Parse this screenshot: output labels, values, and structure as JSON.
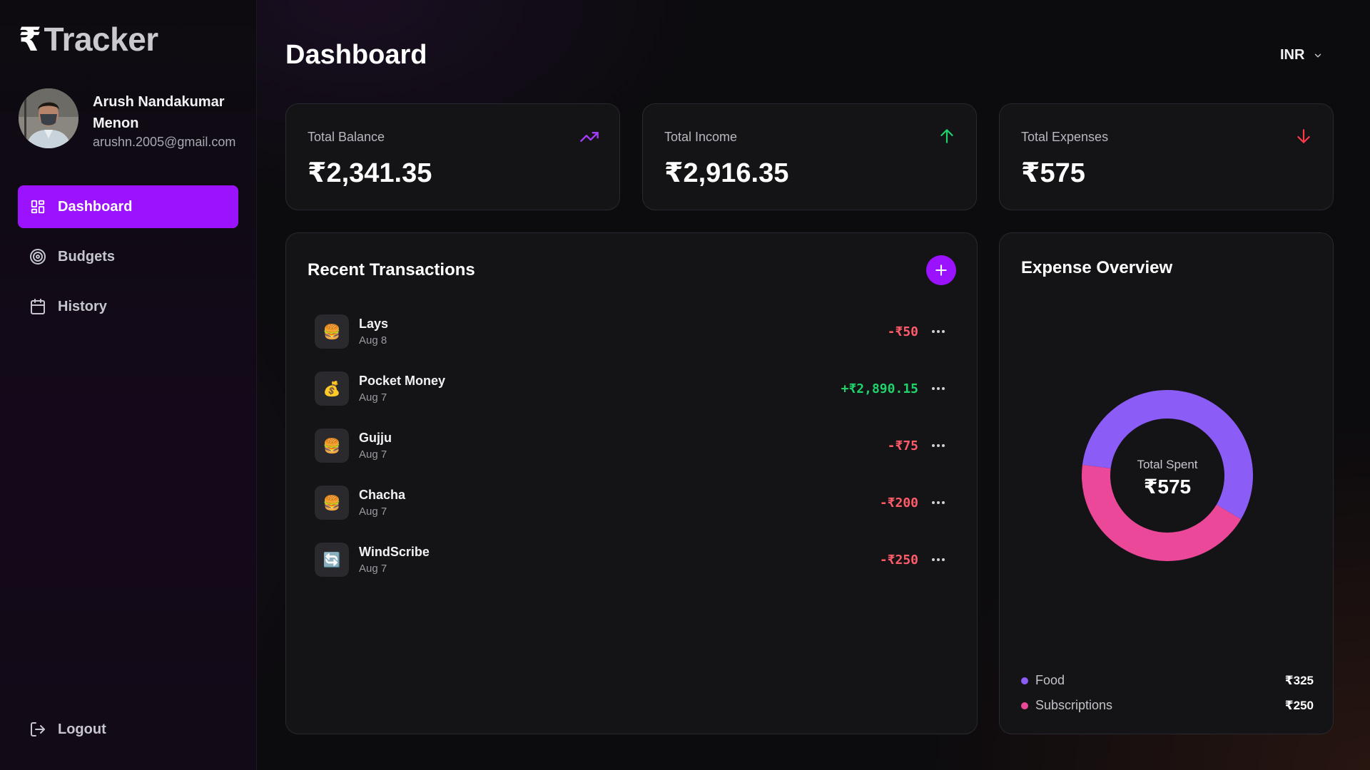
{
  "app": {
    "logo_symbol": "₹",
    "logo_text": "Tracker"
  },
  "user": {
    "name": "Arush Nandakumar Menon",
    "email": "arushn.2005@gmail.com"
  },
  "sidebar": {
    "items": [
      {
        "label": "Dashboard",
        "icon": "dashboard-grid-icon",
        "active": true
      },
      {
        "label": "Budgets",
        "icon": "target-icon",
        "active": false
      },
      {
        "label": "History",
        "icon": "calendar-icon",
        "active": false
      }
    ],
    "logout_label": "Logout"
  },
  "header": {
    "title": "Dashboard",
    "currency": "INR"
  },
  "stats": {
    "balance": {
      "label": "Total Balance",
      "value": "₹2,341.35",
      "icon": "trending-up-icon",
      "color": "#a63cff"
    },
    "income": {
      "label": "Total Income",
      "value": "₹2,916.35",
      "icon": "arrow-up-icon",
      "color": "#1fd36b"
    },
    "expenses": {
      "label": "Total Expenses",
      "value": "₹575",
      "icon": "arrow-down-icon",
      "color": "#ff3b4a"
    }
  },
  "transactions": {
    "title": "Recent Transactions",
    "items": [
      {
        "name": "Lays",
        "date": "Aug 8",
        "amount": "-₹50",
        "type": "expense",
        "icon": "🍔"
      },
      {
        "name": "Pocket Money",
        "date": "Aug 7",
        "amount": "+₹2,890.15",
        "type": "income",
        "icon": "💰"
      },
      {
        "name": "Gujju",
        "date": "Aug 7",
        "amount": "-₹75",
        "type": "expense",
        "icon": "🍔"
      },
      {
        "name": "Chacha",
        "date": "Aug 7",
        "amount": "-₹200",
        "type": "expense",
        "icon": "🍔"
      },
      {
        "name": "WindScribe",
        "date": "Aug 7",
        "amount": "-₹250",
        "type": "expense",
        "icon": "🔄"
      }
    ]
  },
  "expense_overview": {
    "title": "Expense Overview",
    "center_label": "Total Spent",
    "center_value": "₹575",
    "categories": [
      {
        "name": "Food",
        "amount": "₹325",
        "value": 325,
        "color": "#8b5cf6"
      },
      {
        "name": "Subscriptions",
        "amount": "₹250",
        "value": 250,
        "color": "#ec4899"
      }
    ]
  },
  "colors": {
    "accent": "#9b12ff",
    "positive": "#1fd36b",
    "negative": "#ff5c6a"
  }
}
